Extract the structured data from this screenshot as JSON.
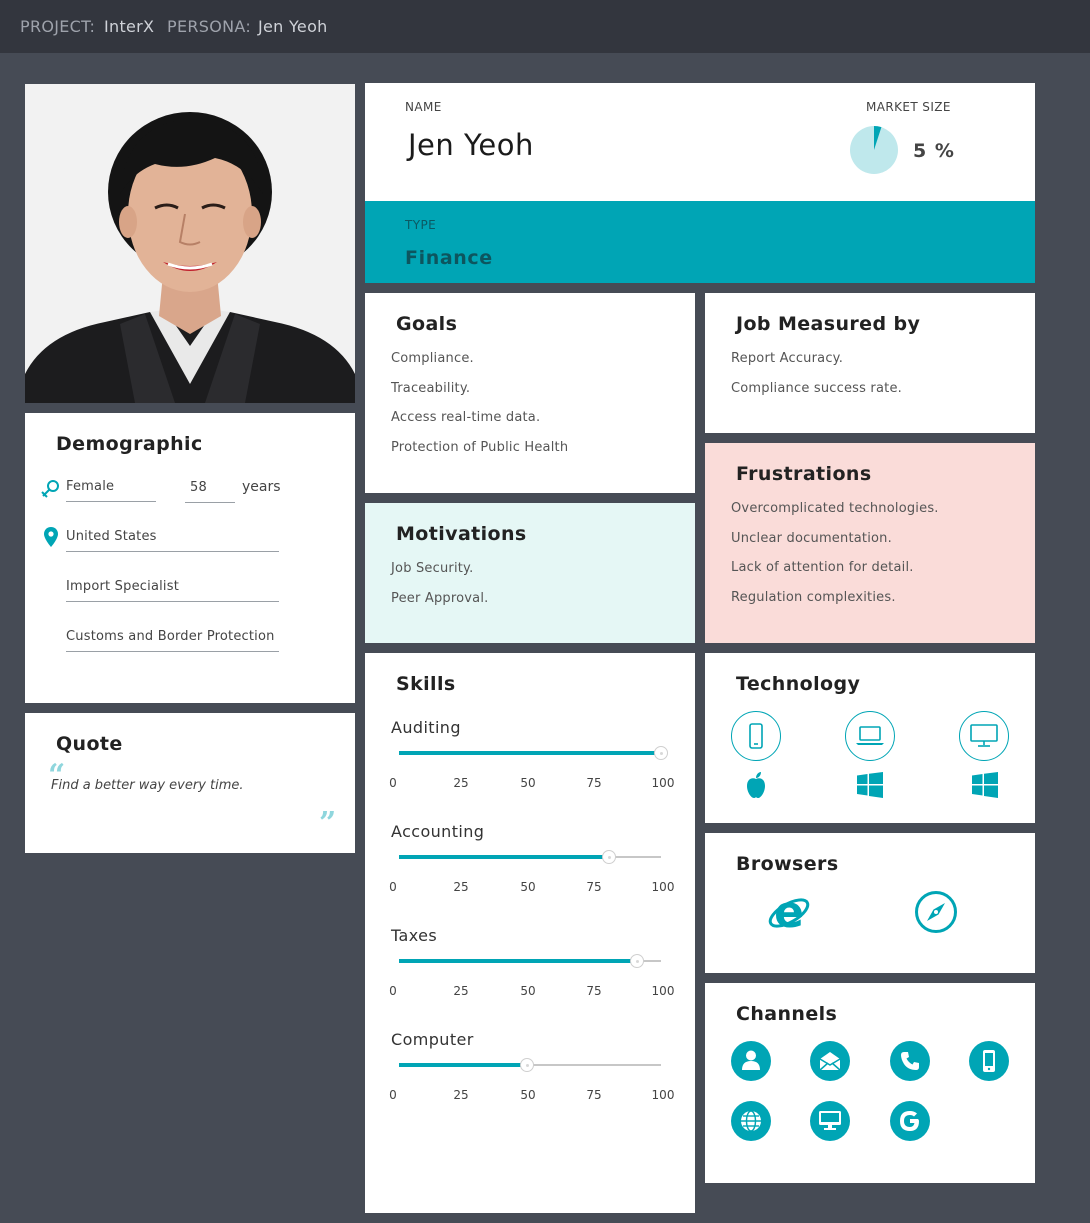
{
  "header": {
    "project_label": "PROJECT:",
    "project_value": "InterX",
    "persona_label": "PERSONA:",
    "persona_value": "Jen Yeoh"
  },
  "profile": {
    "name_label": "NAME",
    "name": "Jen Yeoh",
    "market_size_label": "MARKET SIZE",
    "market_size_value": "5 %",
    "market_size_fraction": 0.05,
    "type_label": "TYPE",
    "type_value": "Finance"
  },
  "demographic": {
    "title": "Demographic",
    "gender": "Female",
    "age": "58",
    "age_unit": "years",
    "location": "United States",
    "occupation": "Import Specialist",
    "organization": "Customs and Border Protection"
  },
  "quote": {
    "title": "Quote",
    "open_mark": "“",
    "text": "Find a better way every time.",
    "close_mark": "”"
  },
  "goals": {
    "title": "Goals",
    "items": [
      "Compliance.",
      "Traceability.",
      "Access real-time data.",
      "Protection of Public Health"
    ]
  },
  "job_measured_by": {
    "title": "Job Measured by",
    "items": [
      "Report Accuracy.",
      "Compliance success rate."
    ]
  },
  "motivations": {
    "title": "Motivations",
    "items": [
      "Job Security.",
      "Peer Approval."
    ]
  },
  "frustrations": {
    "title": "Frustrations",
    "items": [
      "Overcomplicated technologies.",
      "Unclear documentation.",
      "Lack of attention for detail.",
      "Regulation complexities."
    ]
  },
  "skills": {
    "title": "Skills",
    "ticks": [
      "0",
      "25",
      "50",
      "75",
      "100"
    ],
    "items": [
      {
        "name": "Auditing",
        "value": 100
      },
      {
        "name": "Accounting",
        "value": 80
      },
      {
        "name": "Taxes",
        "value": 91
      },
      {
        "name": "Computer",
        "value": 49
      }
    ]
  },
  "technology": {
    "title": "Technology",
    "devices": [
      "mobile-icon",
      "laptop-icon",
      "desktop-icon"
    ],
    "platforms": [
      "apple-icon",
      "windows-icon",
      "windows-icon"
    ]
  },
  "browsers": {
    "title": "Browsers",
    "items": [
      "internet-explorer-icon",
      "safari-icon"
    ]
  },
  "channels": {
    "title": "Channels",
    "items": [
      "person-icon",
      "email-icon",
      "phone-icon",
      "mobile-icon",
      "web-icon",
      "desktop-icon",
      "google-icon"
    ]
  },
  "colors": {
    "accent": "#00a5b5",
    "page_bg": "#464b55",
    "topbar_bg": "#33363e",
    "motivations_bg": "#e5f7f5",
    "frustrations_bg": "#fadcd9"
  }
}
